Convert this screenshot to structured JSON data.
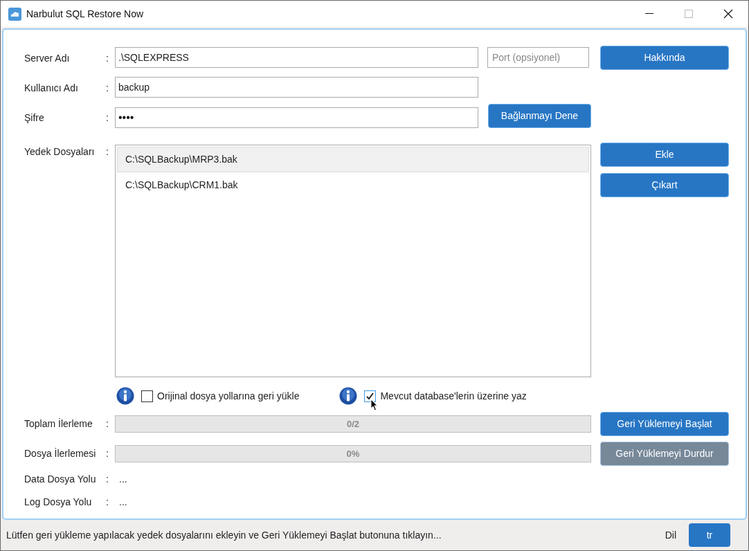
{
  "window": {
    "title": "Narbulut SQL Restore Now"
  },
  "connection": {
    "server": {
      "label": "Server Adı",
      "separator": ":",
      "value": ".\\SQLEXPRESS"
    },
    "port": {
      "placeholder": "Port (opsiyonel)"
    },
    "user": {
      "label": "Kullanıcı Adı",
      "separator": ":",
      "value": "backup"
    },
    "password": {
      "label": "Şifre",
      "separator": ":",
      "value": "••••"
    },
    "about_button": "Hakkında",
    "test_button": "Bağlanmayı Dene"
  },
  "backups": {
    "label": "Yedek Dosyaları",
    "separator": ":",
    "files": [
      {
        "path": "C:\\SQLBackup\\MRP3.bak",
        "selected": true
      },
      {
        "path": "C:\\SQLBackup\\CRM1.bak",
        "selected": false
      }
    ],
    "add_button": "Ekle",
    "remove_button": "Çıkart"
  },
  "options": [
    {
      "label": "Orijinal dosya yollarına geri yükle",
      "checked": false
    },
    {
      "label": "Mevcut database'lerin üzerine yaz",
      "checked": true
    }
  ],
  "progress": [
    {
      "label": "Toplam İlerleme",
      "separator": ":",
      "reading": "0/2",
      "level": 0,
      "button": "Geri Yüklemeyi Başlat",
      "disabled": false
    },
    {
      "label": "Dosya İlerlemesi",
      "separator": ":",
      "reading": "0%",
      "level": 0,
      "button": "Geri Yüklemeyi Durdur",
      "disabled": true
    }
  ],
  "paths": [
    {
      "label": "Data Dosya Yolu",
      "separator": ":",
      "value": "..."
    },
    {
      "label": "Log Dosya Yolu",
      "separator": ":",
      "value": "..."
    }
  ],
  "status_bar": {
    "message": "Lütfen geri yükleme yapılacak yedek dosyalarını ekleyin ve Geri Yüklemeyi Başlat butonuna tıklayın...",
    "language_label": "Dil",
    "language_button": "tr"
  }
}
